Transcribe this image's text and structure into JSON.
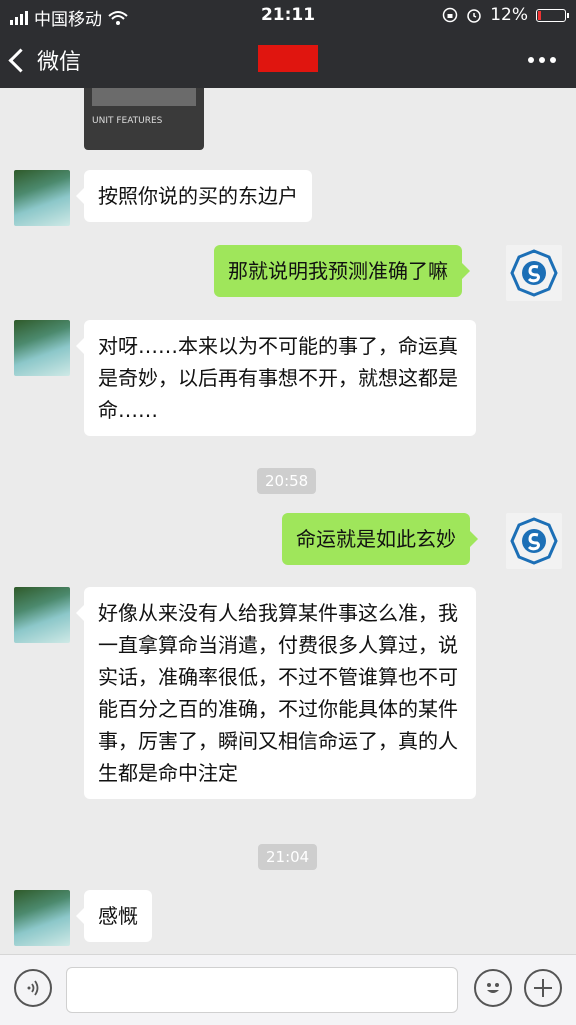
{
  "status_bar": {
    "carrier": "中国移动",
    "time": "21:11",
    "battery": "12%",
    "battery_level": 0.12
  },
  "nav": {
    "back_label": "微信",
    "title_redacted_color": "#e0150f"
  },
  "chat": {
    "image_message": {
      "caption": "UNIT FEATURES"
    },
    "messages": [
      {
        "side": "left",
        "text": "按照你说的买的东边户"
      },
      {
        "side": "right",
        "text": "那就说明我预测准确了嘛"
      },
      {
        "side": "left",
        "text": "对呀……本来以为不可能的事了，命运真是奇妙，以后再有事想不开，就想这都是命……"
      },
      {
        "timestamp": "20:58"
      },
      {
        "side": "right",
        "text": "命运就是如此玄妙"
      },
      {
        "side": "left",
        "text": "好像从来没有人给我算某件事这么准，我一直拿算命当消遣，付费很多人算过，说实话，准确率很低，不过不管谁算也不可能百分之百的准确，不过你能具体的某件事，厉害了，瞬间又相信命运了，真的人生都是命中注定"
      },
      {
        "timestamp": "21:04"
      },
      {
        "side": "left",
        "text": "感慨"
      }
    ]
  },
  "input_bar": {
    "voice_icon": "voice-icon",
    "emoji_icon": "emoji-icon",
    "plus_icon": "plus-icon"
  },
  "colors": {
    "header_bg": "#2d2e31",
    "chat_bg": "#ebebeb",
    "outgoing_bubble": "#9fe65b",
    "incoming_bubble": "#ffffff"
  }
}
